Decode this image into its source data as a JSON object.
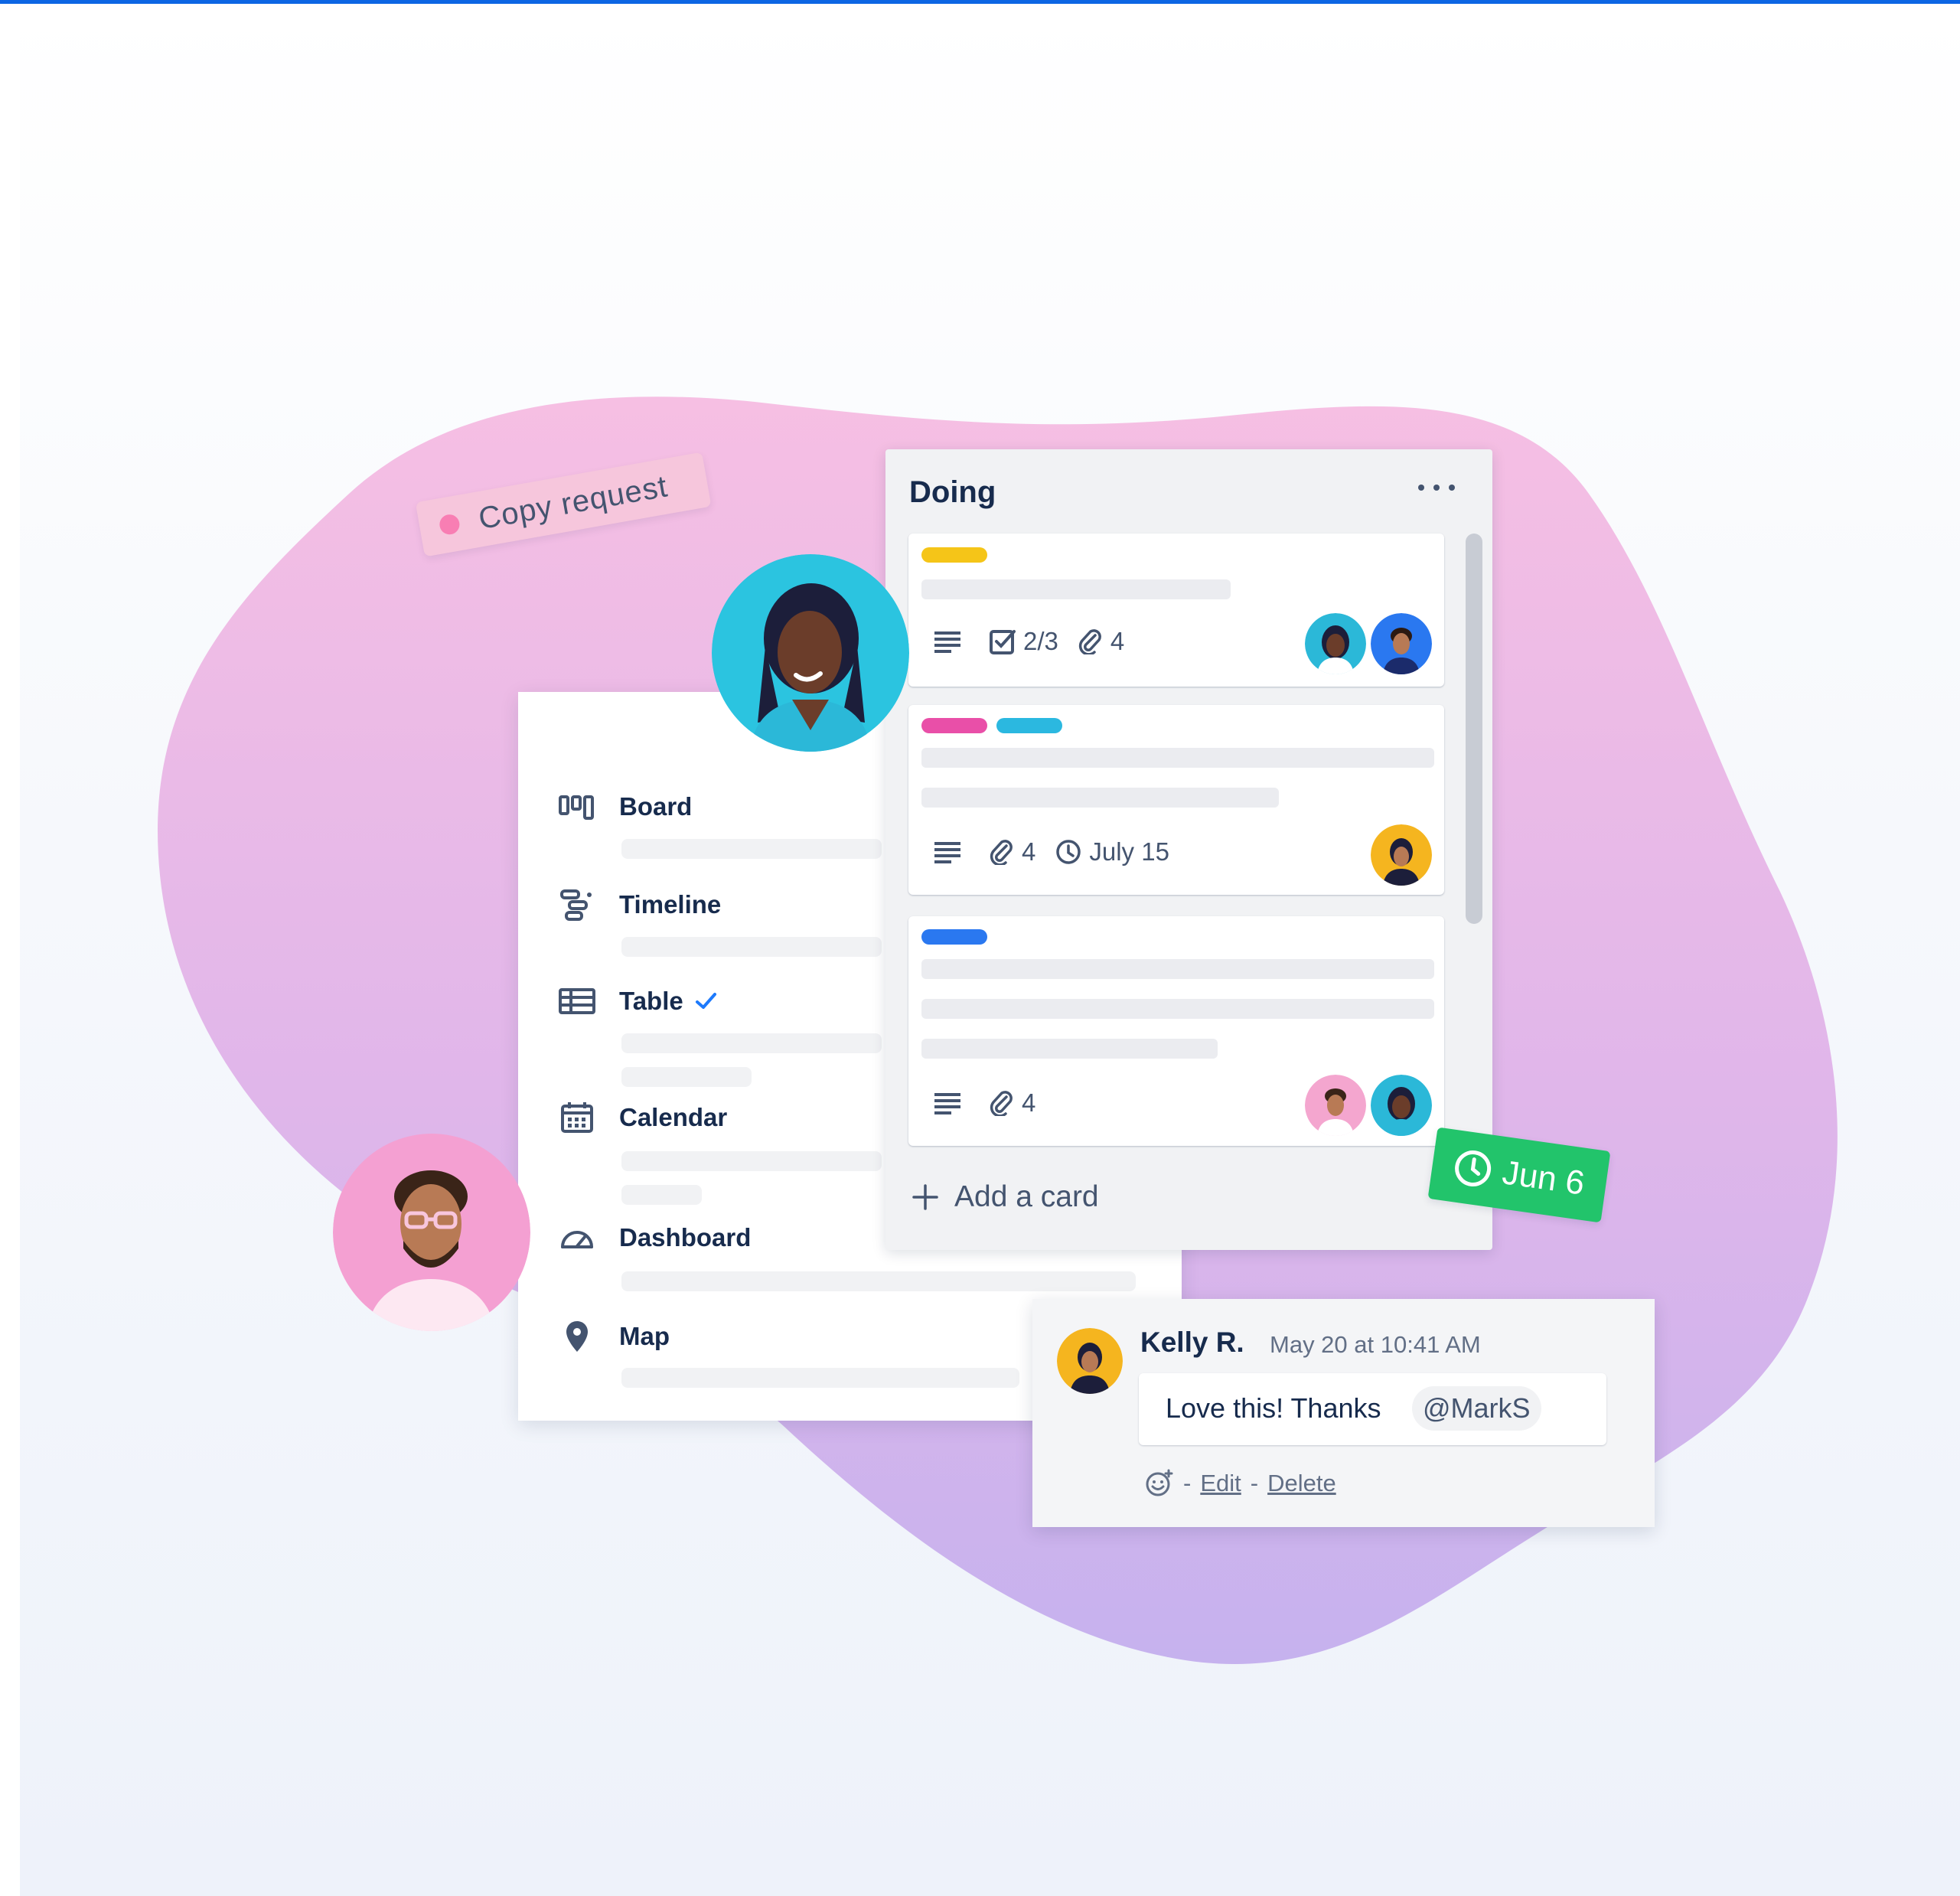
{
  "sticker": {
    "copy_request": "Copy request"
  },
  "views": [
    {
      "label": "Board",
      "icon": "board-icon"
    },
    {
      "label": "Timeline",
      "icon": "timeline-icon"
    },
    {
      "label": "Table",
      "icon": "table-icon",
      "selected": true
    },
    {
      "label": "Calendar",
      "icon": "calendar-icon"
    },
    {
      "label": "Dashboard",
      "icon": "dashboard-icon"
    },
    {
      "label": "Map",
      "icon": "map-pin-icon"
    }
  ],
  "list": {
    "title": "Doing",
    "cards": [
      {
        "labels": [
          "#f5c518"
        ],
        "checklist": "2/3",
        "attachments": "4"
      },
      {
        "labels": [
          "#e94fa8",
          "#2bb8e0"
        ],
        "attachments": "4",
        "due": "July 15"
      },
      {
        "labels": [
          "#2a78f0"
        ],
        "attachments": "4"
      }
    ],
    "add_card": "Add a card"
  },
  "due_chip": {
    "label": "Jun 6"
  },
  "comment": {
    "author": "Kelly R.",
    "time": "May 20 at 10:41 AM",
    "text": "Love this! Thanks",
    "mention": "@MarkS",
    "edit": "Edit",
    "delete": "Delete",
    "separator": "-"
  },
  "colors": {
    "accent": "#0c66e4",
    "blob_top": "#f4bde0",
    "blob_bottom": "#c8b4ee",
    "green_chip": "#22c46b",
    "pink_chip": "#f6c6dc"
  }
}
